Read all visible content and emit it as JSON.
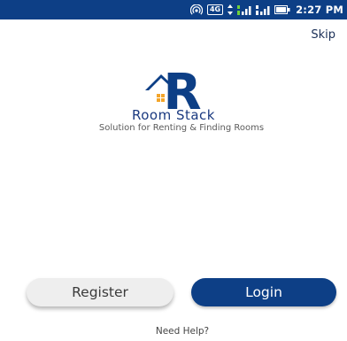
{
  "status_bar": {
    "network_badge": "4G",
    "time": "2:27 PM",
    "icons": [
      "hotspot-icon",
      "data-transfer-icon",
      "signal-icon",
      "signal-icon",
      "battery-icon"
    ]
  },
  "header": {
    "skip_label": "Skip"
  },
  "logo": {
    "letter": "R",
    "brand_name": "Room Stack",
    "tagline": "Solution for Renting & Finding Rooms"
  },
  "actions": {
    "register_label": "Register",
    "login_label": "Login",
    "help_label": "Need Help?"
  },
  "colors": {
    "primary": "#0d3f86",
    "accent": "#f3a52a",
    "register_bg": "#eeeeee"
  }
}
